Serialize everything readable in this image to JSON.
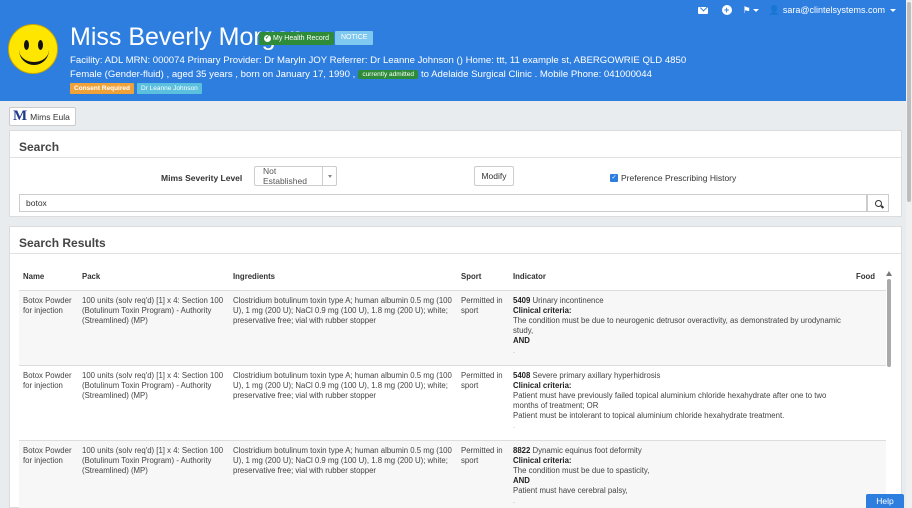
{
  "topnav": {
    "user_email": "sara@clintelsystems.com"
  },
  "patient": {
    "name": "Miss Beverly Morgan",
    "my_health_record": "My Health Record",
    "notice": "NOTICE",
    "line1": "Facility: ADL   MRN: 000074   Primary Provider: Dr Maryln JOY   Referrer: Dr Leanne Johnson ()   Home: ttt, 11 example st, ABERGOWRIE QLD 4850",
    "line2_prefix": "Female (Gender-fluid) , aged 35 years , born on January 17, 1990 ,",
    "admitted_badge": "currently admitted",
    "line2_suffix": "to Adelaide Surgical Clinic . Mobile Phone: 041000044",
    "consent_badge": "Consent Required",
    "doctor_badge": "Dr Leanne Johnson"
  },
  "mims_tab": {
    "logo": "M",
    "label": "Mims Eula"
  },
  "search_panel": {
    "title": "Search",
    "severity_label": "Mims Severity Level",
    "severity_value": "Not Established",
    "modify_label": "Modify",
    "preference_label": "Preference Prescribing History",
    "preference_checked": true,
    "query": "botox"
  },
  "results": {
    "title": "Search Results",
    "columns": [
      "Name",
      "Pack",
      "Ingredients",
      "Sport",
      "Indicator",
      "Food"
    ],
    "rows": [
      {
        "name": "Botox Powder for injection",
        "pack": "100 units (solv req'd) [1] x 4: Section 100 (Botulinum Toxin Program) - Authority (Streamlined) (MP)",
        "ingredients": "Clostridium botulinum toxin type A; human albumin 0.5 mg (100 U), 1 mg (200 U); NaCl 0.9 mg (100 U), 1.8 mg (200 U); white; preservative free; vial with rubber stopper",
        "sport": "Permitted in sport",
        "code": "5409",
        "indication": "Urinary incontinence",
        "criteria_head": "Clinical criteria:",
        "criteria1": "The condition must be due to neurogenic detrusor overactivity, as demonstrated by urodynamic study,",
        "joiner": "AND",
        "criteria2": "",
        "tail": "."
      },
      {
        "name": "Botox Powder for injection",
        "pack": "100 units (solv req'd) [1] x 4: Section 100 (Botulinum Toxin Program) - Authority (Streamlined) (MP)",
        "ingredients": "Clostridium botulinum toxin type A; human albumin 0.5 mg (100 U), 1 mg (200 U); NaCl 0.9 mg (100 U), 1.8 mg (200 U); white; preservative free; vial with rubber stopper",
        "sport": "Permitted in sport",
        "code": "5408",
        "indication": "Severe primary axillary hyperhidrosis",
        "criteria_head": "Clinical criteria:",
        "criteria1": "Patient must have previously failed topical aluminium chloride hexahydrate after one to two months of treatment; OR",
        "joiner": "",
        "criteria2": "Patient must be intolerant to topical aluminium chloride hexahydrate treatment.",
        "tail": "."
      },
      {
        "name": "Botox Powder for injection",
        "pack": "100 units (solv req'd) [1] x 4: Section 100 (Botulinum Toxin Program) - Authority (Streamlined) (MP)",
        "ingredients": "Clostridium botulinum toxin type A; human albumin 0.5 mg (100 U), 1 mg (200 U); NaCl 0.9 mg (100 U), 1.8 mg (200 U); white; preservative free; vial with rubber stopper",
        "sport": "Permitted in sport",
        "code": "8822",
        "indication": "Dynamic equinus foot deformity",
        "criteria_head": "Clinical criteria:",
        "criteria1": "The condition must be due to spasticity,",
        "joiner": "AND",
        "criteria2": "Patient must have cerebral palsy,",
        "tail": "."
      }
    ]
  },
  "help": {
    "label": "Help"
  },
  "colors": {
    "header_blue": "#2e7ee0",
    "mhr_green": "#2e8b3a",
    "notice_blue": "#7fc8ef",
    "consent_orange": "#f0a23a",
    "doctor_teal": "#5bc0de"
  }
}
